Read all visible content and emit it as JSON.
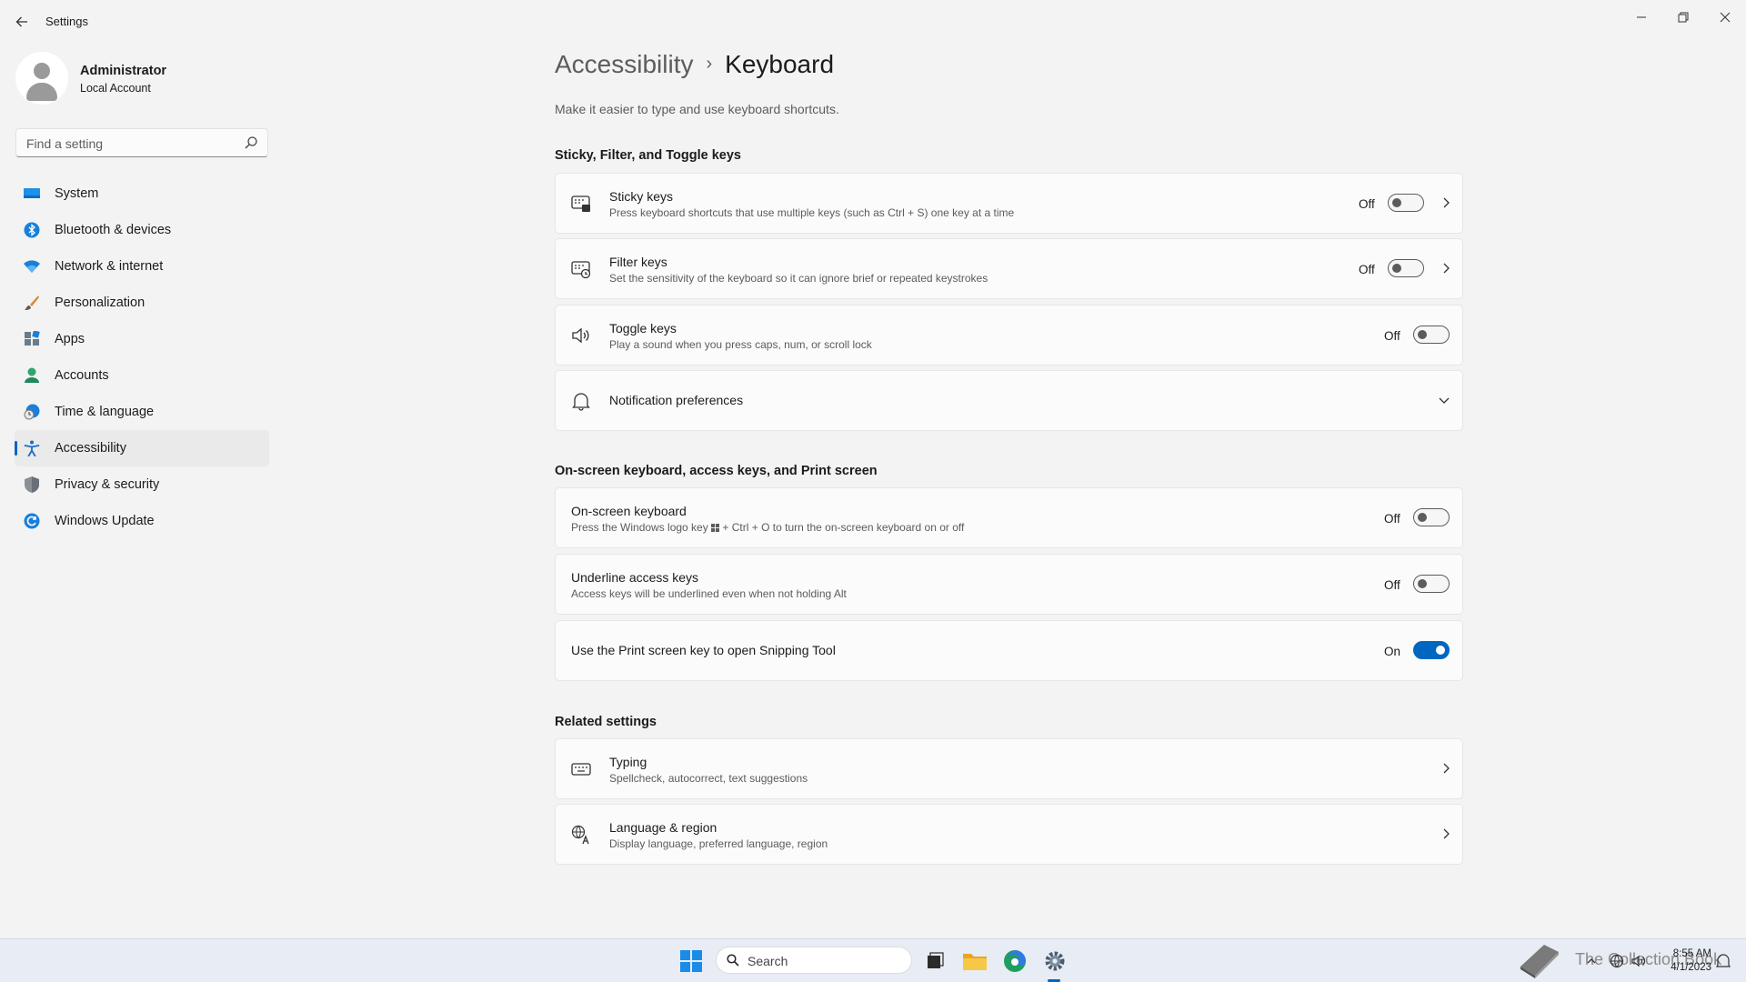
{
  "window": {
    "title": "Settings",
    "back_icon": "arrow-left-icon",
    "minimize": "—",
    "maximize": "▢",
    "close": "✕"
  },
  "user": {
    "name": "Administrator",
    "account_type": "Local Account"
  },
  "search": {
    "placeholder": "Find a setting"
  },
  "sidebar": {
    "items": [
      {
        "label": "System",
        "icon": "system-icon"
      },
      {
        "label": "Bluetooth & devices",
        "icon": "bluetooth-icon"
      },
      {
        "label": "Network & internet",
        "icon": "wifi-icon"
      },
      {
        "label": "Personalization",
        "icon": "brush-icon"
      },
      {
        "label": "Apps",
        "icon": "apps-icon"
      },
      {
        "label": "Accounts",
        "icon": "accounts-icon"
      },
      {
        "label": "Time & language",
        "icon": "time-language-icon"
      },
      {
        "label": "Accessibility",
        "icon": "accessibility-icon",
        "active": true
      },
      {
        "label": "Privacy & security",
        "icon": "shield-icon"
      },
      {
        "label": "Windows Update",
        "icon": "update-icon"
      }
    ]
  },
  "page": {
    "breadcrumb_parent": "Accessibility",
    "breadcrumb_sep": "›",
    "title": "Keyboard",
    "description": "Make it easier to type and use keyboard shortcuts."
  },
  "sections": {
    "sticky": {
      "title": "Sticky, Filter, and Toggle keys",
      "items": [
        {
          "title": "Sticky keys",
          "subtitle": "Press keyboard shortcuts that use multiple keys (such as Ctrl + S) one key at a time",
          "state": "Off"
        },
        {
          "title": "Filter keys",
          "subtitle": "Set the sensitivity of the keyboard so it can ignore brief or repeated keystrokes",
          "state": "Off"
        },
        {
          "title": "Toggle keys",
          "subtitle": "Play a sound when you press caps, num, or scroll lock",
          "state": "Off"
        },
        {
          "title": "Notification preferences"
        }
      ]
    },
    "onscreen": {
      "title": "On-screen keyboard, access keys, and Print screen",
      "items": [
        {
          "title": "On-screen keyboard",
          "subtitle_before": "Press the Windows logo key",
          "subtitle_after": "+ Ctrl + O to turn the on-screen keyboard on or off",
          "state": "Off"
        },
        {
          "title": "Underline access keys",
          "subtitle": "Access keys will be underlined even when not holding Alt",
          "state": "Off"
        },
        {
          "title": "Use the Print screen key to open Snipping Tool",
          "state": "On"
        }
      ]
    },
    "related": {
      "title": "Related settings",
      "items": [
        {
          "title": "Typing",
          "subtitle": "Spellcheck, autocorrect, text suggestions"
        },
        {
          "title": "Language & region",
          "subtitle": "Display language, preferred language, region"
        }
      ]
    }
  },
  "taskbar": {
    "search_label": "Search",
    "watermark": "The Collection Book",
    "time": "8:55 AM",
    "date": "4/1/2023"
  },
  "colors": {
    "accent": "#0067c0",
    "background": "#f3f3f3",
    "card": "#fbfbfb"
  }
}
